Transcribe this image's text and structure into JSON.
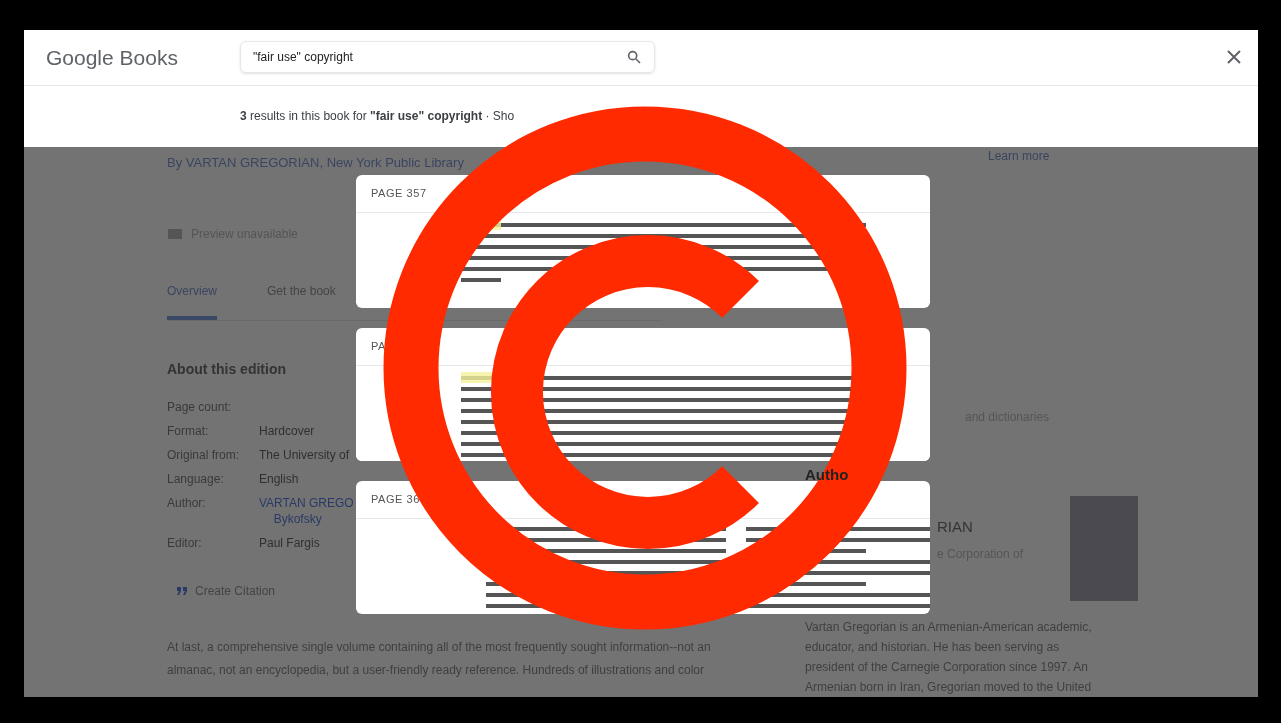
{
  "header": {
    "logo": "Google Books",
    "search": {
      "value": "\"fair use\" copyright"
    }
  },
  "results_bar": {
    "text": "**3** results in this book for **\"fair use\" copyright** · Sho"
  },
  "book": {
    "byline": "By VARTAN GREGORIAN, New York Public Library",
    "preview": "Preview unavailable",
    "tabs": [
      {
        "label": "Overview",
        "selected": true
      },
      {
        "label": "Get the book",
        "selected": false
      }
    ],
    "about": {
      "heading": "About this edition",
      "rows": [
        {
          "label": "Page count:"
        },
        {
          "label": "Format:",
          "value": "Hardcover"
        },
        {
          "label": "Original from:",
          "value": "The University of"
        },
        {
          "label": "Language:",
          "value": "English"
        },
        {
          "label": "Author:",
          "value": "VARTAN GREGO",
          "link": true,
          "extra": "Bykofsky"
        },
        {
          "label": "Editor:",
          "value": "Paul Fargis"
        }
      ]
    },
    "citation": "Create Citation",
    "description": "At last, a comprehensive single volume containing all of the most frequently sought information--not an almanac, not an encyclopedia, but a user-friendly ready reference. Hundreds of illustrations and color"
  },
  "side": {
    "learn_more": "Learn more",
    "fragment": "and dictionaries",
    "author_heading": "Autho",
    "author_name": "RIAN",
    "author_subtitle": "e Corporation of",
    "bio": "Vartan Gregorian is an Armenian-American academic, educator, and historian. He has been serving as president of the Carnegie Corporation since 1997. An Armenian born in Iran, Gregorian moved to the United"
  },
  "snippets": [
    {
      "page": "PAGE 357",
      "kind": "single"
    },
    {
      "page": "PA",
      "kind": "single"
    },
    {
      "page": "PAGE 36",
      "kind": "double"
    }
  ]
}
